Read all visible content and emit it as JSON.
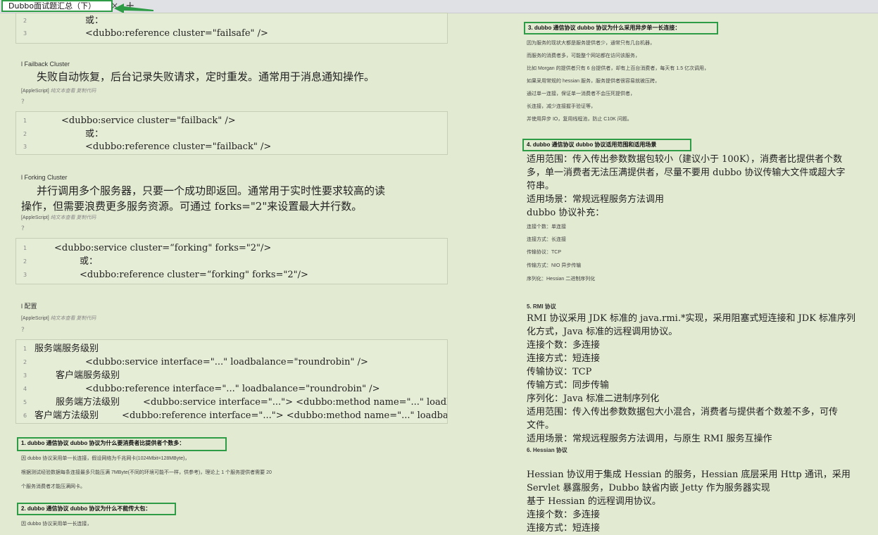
{
  "tab": {
    "title": "Dubbo面试题汇总（下）",
    "close": "×",
    "new": "+"
  },
  "left": {
    "code1": [
      {
        "n": "2",
        "t": "或："
      },
      {
        "n": "3",
        "t": "<dubbo:reference cluster=\"failsafe\" />"
      }
    ],
    "failback": {
      "heading": "l Failback Cluster",
      "desc": "失败自动恢复，后台记录失败请求，定时重发。通常用于消息通知操作。",
      "meta_tag": "[AppleScript]",
      "meta_links": "纯文本查看 复制代码",
      "q": "?",
      "code": [
        {
          "n": "1",
          "t": "<dubbo:service cluster=\"failback\" />"
        },
        {
          "n": "2",
          "t": "或："
        },
        {
          "n": "3",
          "t": "<dubbo:reference cluster=\"failback\" />"
        }
      ]
    },
    "forking": {
      "heading": "l Forking Cluster",
      "desc1": "并行调用多个服务器，只要一个成功即返回。通常用于实时性要求较高的读",
      "desc2": "操作，但需要浪费更多服务资源。可通过 forks=\"2\"来设置最大并行数。",
      "meta_tag": "[AppleScript]",
      "meta_links": "纯文本查看 复制代码",
      "q": "?",
      "code": [
        {
          "n": "1",
          "t": "<dubbo:service cluster=“forking\" forks=\"2\"/>"
        },
        {
          "n": "2",
          "t": "或："
        },
        {
          "n": "3",
          "t": "<dubbo:reference cluster=“forking\" forks=\"2\"/>"
        }
      ]
    },
    "config": {
      "heading": "l 配置",
      "meta_tag": "[AppleScript]",
      "meta_links": "纯文本查看 复制代码",
      "q": "?",
      "code": [
        {
          "n": "1",
          "t": "服务端服务级别"
        },
        {
          "n": "2",
          "t": "<dubbo:service interface=\"...\" loadbalance=\"roundrobin\" />"
        },
        {
          "n": "3",
          "t": "客户端服务级别"
        },
        {
          "n": "4",
          "t": "<dubbo:reference interface=\"...\" loadbalance=\"roundrobin\" />"
        },
        {
          "n": "5",
          "t": "服务端方法级别        <dubbo:service interface=\"...\"> <dubbo:method name=\"...\" loadbalance"
        },
        {
          "n": "6",
          "t": "客户端方法级别        <dubbo:reference interface=\"...\"> <dubbo:method name=\"...\" loadbalance='"
        }
      ]
    },
    "q1": {
      "title": "1. dubbo 通信协议 dubbo 协议为什么要消费者比提供者个数多：",
      "lines": [
        "因 dubbo 协议采用单一长连接，假设网络为千兆网卡(1024Mbit=128MByte)，",
        "根据测试经验数据每条连接最多只能压满 7MByte(不同的环境可能不一样，供参考)，理论上 1 个服务提供者需要 20",
        "个服务消费者才能压满网卡。"
      ]
    },
    "q2": {
      "title": "2. dubbo 通信协议 dubbo 协议为什么不能传大包：",
      "lines": [
        "因 dubbo 协议采用单一长连接，"
      ]
    }
  },
  "right": {
    "q3": {
      "title": "3. dubbo 通信协议 dubbo 协议为什么采用异步单一长连接：",
      "lines": [
        "因为服务的现状大都是服务提供者少，通常只有几台机器，",
        "而服务的消费者多，可能整个网站都在访问该服务，",
        "比如 Morgan 的提供者只有 6 台提供者，却有上百台消费者，每天有 1.5 亿次调用，",
        "如果采用常规的 hessian 服务，服务提供者很容易就被压跨，",
        "通过单一连接，保证单一消费者不会压死提供者，",
        "长连接，减少连接握手验证等，",
        "并使用异步 IO，复用线程池，防止 C10K 问题。"
      ]
    },
    "q4": {
      "title": "4. dubbo 通信协议 dubbo 协议适用范围和适用场景",
      "big": [
        "适用范围：传入传出参数数据包较小（建议小于 100K），消费者比提供者个数",
        "多，单一消费者无法压满提供者，尽量不要用 dubbo 协议传输大文件或超大字",
        "符串。",
        "适用场景：常规远程服务方法调用",
        "dubbo 协议补充："
      ],
      "lines": [
        "连接个数：单连接",
        "连接方式：长连接",
        "传输协议：TCP",
        "传输方式：NIO 异步传输",
        "序列化：Hessian 二进制序列化"
      ]
    },
    "rmi": {
      "title": "5. RMI 协议",
      "lines": [
        "RMI 协议采用 JDK 标准的 java.rmi.*实现，采用阻塞式短连接和 JDK 标准序列",
        "化方式，Java 标准的远程调用协议。",
        "连接个数：多连接",
        "连接方式：短连接",
        "传输协议：TCP",
        "传输方式：同步传输",
        "序列化：Java 标准二进制序列化",
        "适用范围：传入传出参数数据包大小混合，消费者与提供者个数差不多，可传",
        "文件。",
        "适用场景：常规远程服务方法调用，与原生 RMI 服务互操作"
      ]
    },
    "hessian": {
      "title": "6. Hessian 协议",
      "lines": [
        "Hessian 协议用于集成 Hessian 的服务，Hessian 底层采用 Http 通讯，采用",
        "Servlet 暴露服务，Dubbo 缺省内嵌 Jetty 作为服务器实现",
        "基于 Hessian 的远程调用协议。",
        "连接个数：多连接",
        "连接方式：短连接"
      ]
    }
  }
}
